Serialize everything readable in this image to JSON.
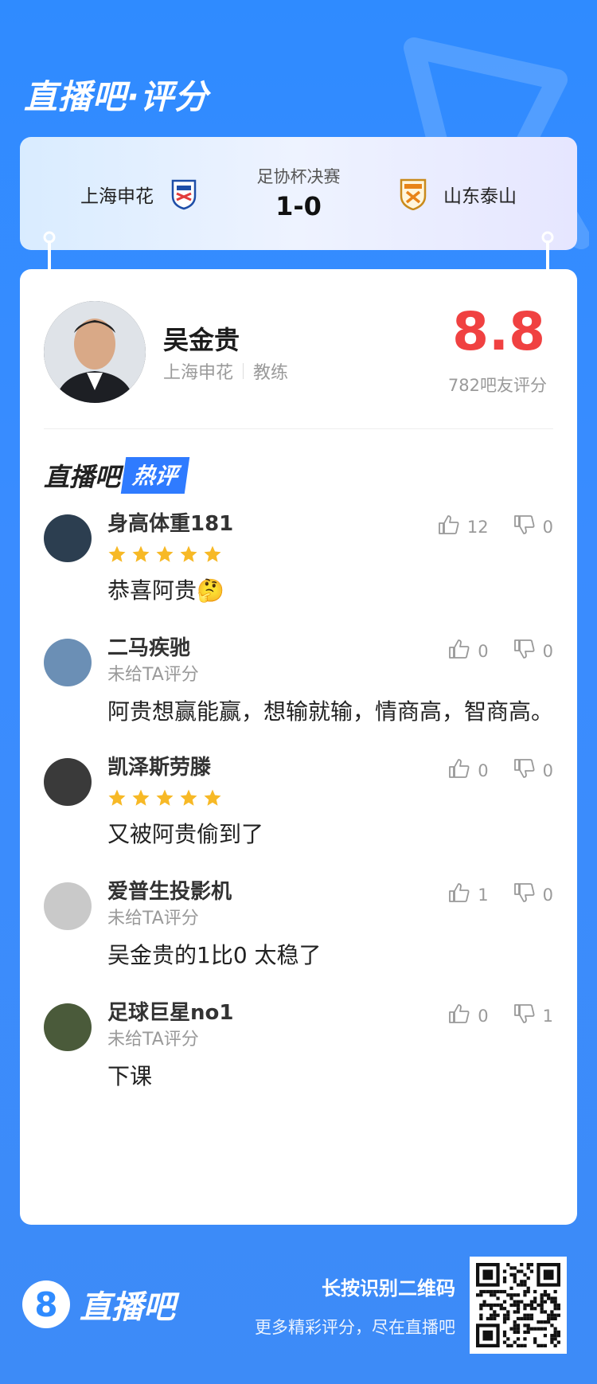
{
  "header": {
    "title": "直播吧·评分"
  },
  "match": {
    "title": "足协杯决赛",
    "score": "1-0",
    "home_team": "上海申花",
    "away_team": "山东泰山"
  },
  "coach": {
    "name": "吴金贵",
    "team": "上海申花",
    "role": "教练",
    "rating": "8.8",
    "rating_count": "782吧友评分"
  },
  "hot": {
    "brand": "直播吧",
    "badge": "热评"
  },
  "comments": [
    {
      "user": "身高体重181",
      "stars": 5,
      "unrated": "",
      "text": "恭喜阿贵🤔",
      "likes": "12",
      "dislikes": "0"
    },
    {
      "user": "二马疾驰",
      "stars": 0,
      "unrated": "未给TA评分",
      "text": "阿贵想赢能赢，想输就输，情商高，智商高。",
      "likes": "0",
      "dislikes": "0"
    },
    {
      "user": "凯泽斯劳滕",
      "stars": 5,
      "unrated": "",
      "text": "又被阿贵偷到了",
      "likes": "0",
      "dislikes": "0"
    },
    {
      "user": "爱普生投影机",
      "stars": 0,
      "unrated": "未给TA评分",
      "text": "吴金贵的1比0 太稳了",
      "likes": "1",
      "dislikes": "0"
    },
    {
      "user": "足球巨星no1",
      "stars": 0,
      "unrated": "未给TA评分",
      "text": "下课",
      "likes": "0",
      "dislikes": "1"
    }
  ],
  "footer": {
    "logo_mark": "8",
    "logo_text": "直播吧",
    "tip_line1": "长按识别二维码",
    "tip_line2": "更多精彩评分，尽在直播吧"
  },
  "colors": {
    "accent": "#2f8bff",
    "rating": "#f04141",
    "star": "#f7b926"
  }
}
